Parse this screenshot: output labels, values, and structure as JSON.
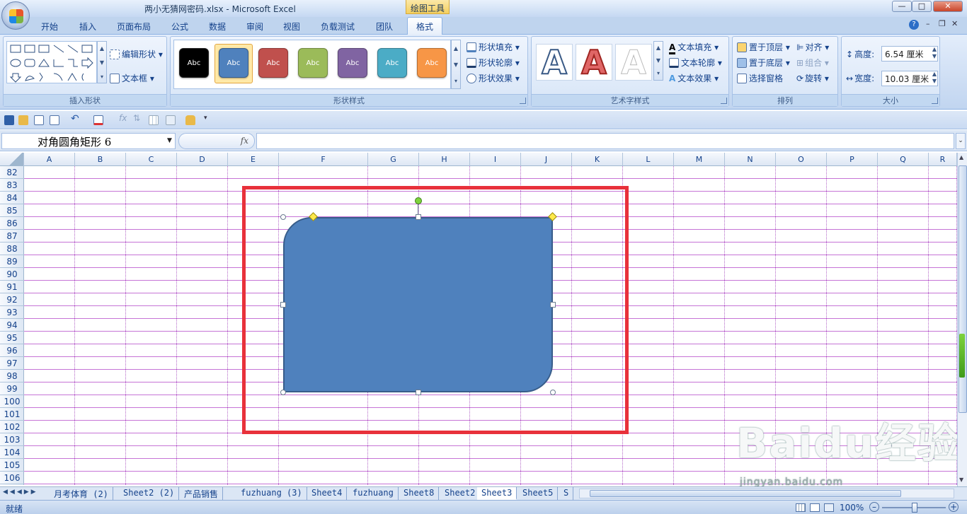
{
  "window": {
    "title": "两小无猜网密码.xlsx - Microsoft Excel",
    "context_tab": "绘图工具",
    "min": "—",
    "max": "□",
    "close": "✕"
  },
  "tabs": [
    {
      "label": "开始"
    },
    {
      "label": "插入"
    },
    {
      "label": "页面布局"
    },
    {
      "label": "公式"
    },
    {
      "label": "数据"
    },
    {
      "label": "审阅"
    },
    {
      "label": "视图"
    },
    {
      "label": "负载测试"
    },
    {
      "label": "团队"
    },
    {
      "label": "格式"
    }
  ],
  "ribbon": {
    "insert_shapes": {
      "label": "插入形状",
      "edit_shape": "编辑形状",
      "textbox": "文本框"
    },
    "shape_styles": {
      "label": "形状样式",
      "fill": "形状填充",
      "outline": "形状轮廓",
      "effects": "形状效果",
      "swatches": [
        {
          "text": "Abc",
          "color": "#000000"
        },
        {
          "text": "Abc",
          "color": "#4f81bd"
        },
        {
          "text": "Abc",
          "color": "#c0504d"
        },
        {
          "text": "Abc",
          "color": "#9bbb59"
        },
        {
          "text": "Abc",
          "color": "#8064a2"
        },
        {
          "text": "Abc",
          "color": "#4bacc6"
        },
        {
          "text": "Abc",
          "color": "#f79646"
        }
      ]
    },
    "wordart": {
      "label": "艺术字样式",
      "text_fill": "文本填充",
      "text_outline": "文本轮廓",
      "text_effects": "文本效果",
      "letter": "A"
    },
    "arrange": {
      "label": "排列",
      "bring_front": "置于顶层",
      "send_back": "置于底层",
      "selection_pane": "选择窗格",
      "align": "对齐",
      "group": "组合",
      "rotate": "旋转"
    },
    "size": {
      "label": "大小",
      "height_label": "高度:",
      "height": "6.54 厘米",
      "width_label": "宽度:",
      "width": "10.03 厘米"
    }
  },
  "formula_bar": {
    "name_box": "对角圆角矩形 6",
    "fx": "fx",
    "formula": ""
  },
  "columns": [
    "A",
    "B",
    "C",
    "D",
    "E",
    "F",
    "G",
    "H",
    "I",
    "J",
    "K",
    "L",
    "M",
    "N",
    "O",
    "P",
    "Q",
    "R"
  ],
  "rows": [
    "82",
    "83",
    "84",
    "85",
    "86",
    "87",
    "88",
    "89",
    "90",
    "91",
    "92",
    "93",
    "94",
    "95",
    "96",
    "97",
    "98",
    "99",
    "100",
    "101",
    "102",
    "103",
    "104",
    "105",
    "106"
  ],
  "sheet_tabs": [
    "月考体育 (2)",
    "Sheet2 (2)",
    "产品销售",
    "fuzhuang (3)",
    "Sheet4",
    "fuzhuang",
    "Sheet8",
    "Sheet2",
    "Sheet3",
    "Sheet5",
    "S"
  ],
  "active_sheet": "Sheet3",
  "status": {
    "mode": "就绪",
    "zoom": "100%"
  },
  "watermark": {
    "brand": "Baidu经验",
    "url": "jingyan.baidu.com"
  },
  "colors": {
    "shape_fill": "#4f81bd",
    "annotation_box": "#e8313b",
    "gridline": "#c674d6"
  }
}
